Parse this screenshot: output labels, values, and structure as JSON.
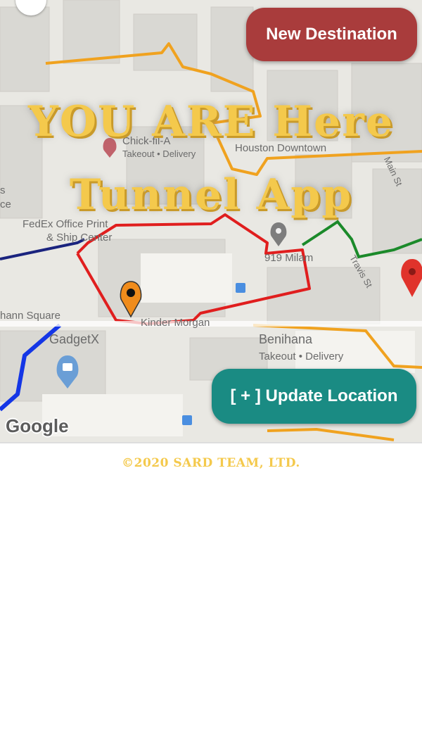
{
  "header": {
    "new_destination_label": "New Destination"
  },
  "title": {
    "line1": "YOU ARE Here",
    "line2": "Tunnel App"
  },
  "map": {
    "labels": {
      "chick_fil_a": "Chick-fil-A",
      "chick_takeout": "Takeout • Delivery",
      "houston_downtown": "Houston Downtown",
      "main_st": "Main St",
      "fedex_1": "FedEx Office Print",
      "fedex_2": "& Ship Center",
      "milam": "919 Milam",
      "travis_st": "Travis St",
      "hann_square": "hann Square",
      "kinder_morgan": "Kinder Morgan",
      "gadgetx": "GadgetX",
      "benihana": "Benihana",
      "benihana_takeout": "Takeout • Delivery",
      "left_s": "s",
      "left_ce": "ce"
    },
    "attribution": "Google"
  },
  "actions": {
    "update_location_label": "[ + ] Update Location"
  },
  "footer": {
    "copyright": "©2020 SARD TEAM, LTD."
  },
  "colors": {
    "new_destination_bg": "#a93c3c",
    "update_location_bg": "#1a8b83",
    "title_text": "#f4c94c"
  }
}
